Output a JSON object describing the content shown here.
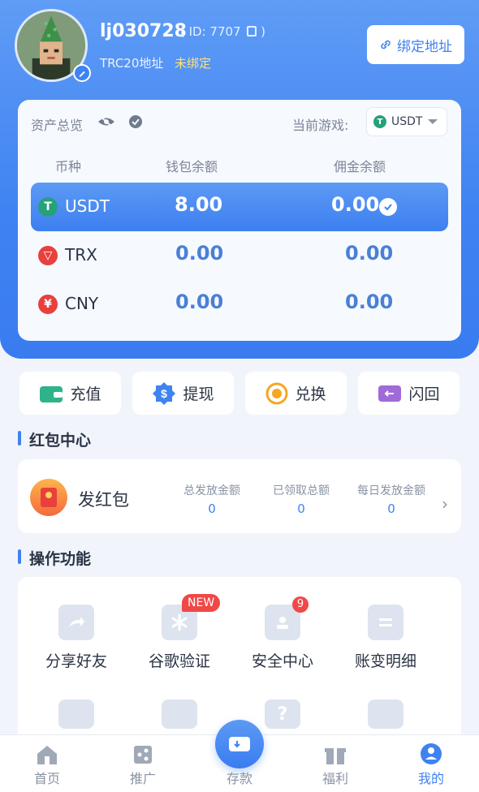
{
  "user": {
    "username": "lj030728",
    "id_text": "( ID: 7707",
    "address_label": "TRC20地址",
    "address_status": "未绑定",
    "bind_button": "绑定地址"
  },
  "assets": {
    "title": "资产总览",
    "current_game_label": "当前游戏:",
    "current_game_value": "USDT",
    "columns": [
      "币种",
      "钱包余额",
      "佣金余额"
    ],
    "rows": [
      {
        "coin": "USDT",
        "wallet": "8.00",
        "commission": "0.00",
        "selected": true
      },
      {
        "coin": "TRX",
        "wallet": "0.00",
        "commission": "0.00",
        "selected": false
      },
      {
        "coin": "CNY",
        "wallet": "0.00",
        "commission": "0.00",
        "selected": false
      }
    ]
  },
  "actions": [
    "充值",
    "提现",
    "兑换",
    "闪回"
  ],
  "redpacket": {
    "section_title": "红包中心",
    "title": "发红包",
    "stats": [
      {
        "label": "总发放金额",
        "value": "0"
      },
      {
        "label": "已领取总额",
        "value": "0"
      },
      {
        "label": "每日发放金额",
        "value": "0"
      }
    ]
  },
  "functions": {
    "section_title": "操作功能",
    "items": [
      "分享好友",
      "谷歌验证",
      "安全中心",
      "账变明细"
    ],
    "new_badge": "NEW",
    "security_count": "9"
  },
  "tabbar": [
    "首页",
    "推广",
    "存款",
    "福利",
    "我的"
  ],
  "colors": {
    "primary": "#3f82f2",
    "accent": "#ffe27a",
    "badge": "#f04848"
  }
}
